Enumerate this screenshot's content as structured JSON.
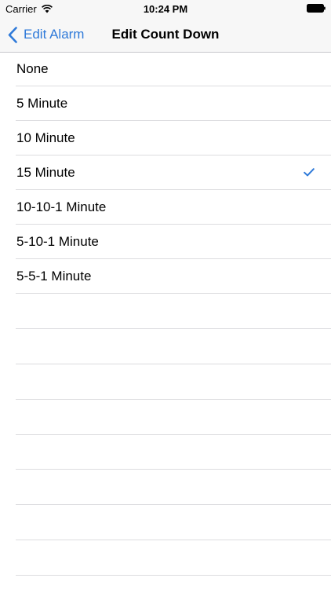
{
  "status_bar": {
    "carrier": "Carrier",
    "time": "10:24 PM",
    "icons": [
      "wifi-icon",
      "battery-icon"
    ]
  },
  "nav_bar": {
    "back_label": "Edit Alarm",
    "title": "Edit Count Down",
    "tint_color": "#2f7ad9"
  },
  "options": [
    {
      "label": "None",
      "selected": false
    },
    {
      "label": "5 Minute",
      "selected": false
    },
    {
      "label": "10 Minute",
      "selected": false
    },
    {
      "label": "15 Minute",
      "selected": true
    },
    {
      "label": "10-10-1 Minute",
      "selected": false
    },
    {
      "label": "5-10-1 Minute",
      "selected": false
    },
    {
      "label": "5-5-1 Minute",
      "selected": false
    }
  ],
  "selected_icon": "checkmark-icon"
}
